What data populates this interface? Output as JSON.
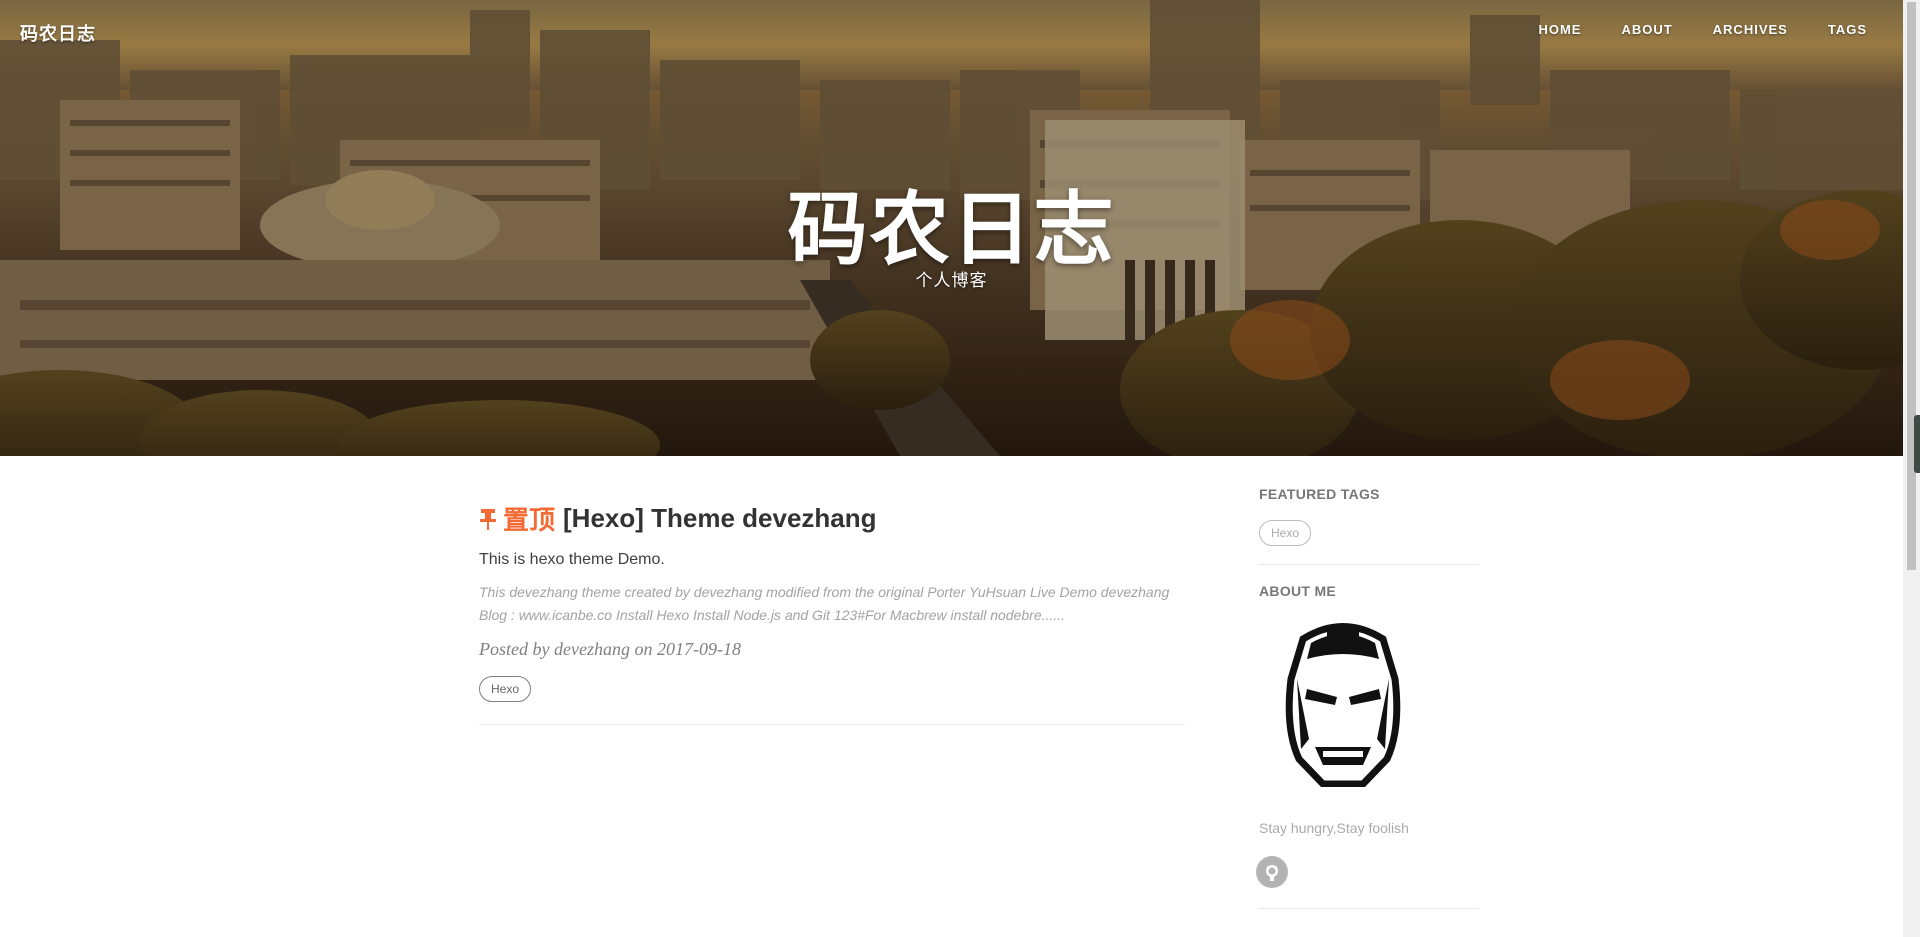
{
  "header": {
    "brand": "码农日志",
    "nav": [
      "HOME",
      "ABOUT",
      "ARCHIVES",
      "TAGS"
    ],
    "title": "码农日志",
    "subtitle": "个人博客"
  },
  "post": {
    "pinned_label": "置顶",
    "title": "[Hexo] Theme devezhang",
    "subtitle": "This is hexo theme Demo.",
    "excerpt": "This devezhang theme created by devezhang modified from the original Porter YuHsuan Live Demo devezhang Blog : www.icanbe.co Install Hexo Install Node.js and Git 123#For Macbrew install nodebre......",
    "meta": "Posted by devezhang on 2017-09-18",
    "tags": [
      "Hexo"
    ]
  },
  "sidebar": {
    "featured_tags_heading": "FEATURED TAGS",
    "featured_tags": [
      "Hexo"
    ],
    "about_heading": "ABOUT ME",
    "motto": "Stay hungry,Stay foolish"
  },
  "icons": {
    "pin": "pushpin-icon",
    "github": "github-icon",
    "avatar": "iron-man-mask"
  },
  "colors": {
    "accent": "#f46a35",
    "text": "#404040",
    "muted": "#a3a3a3"
  }
}
